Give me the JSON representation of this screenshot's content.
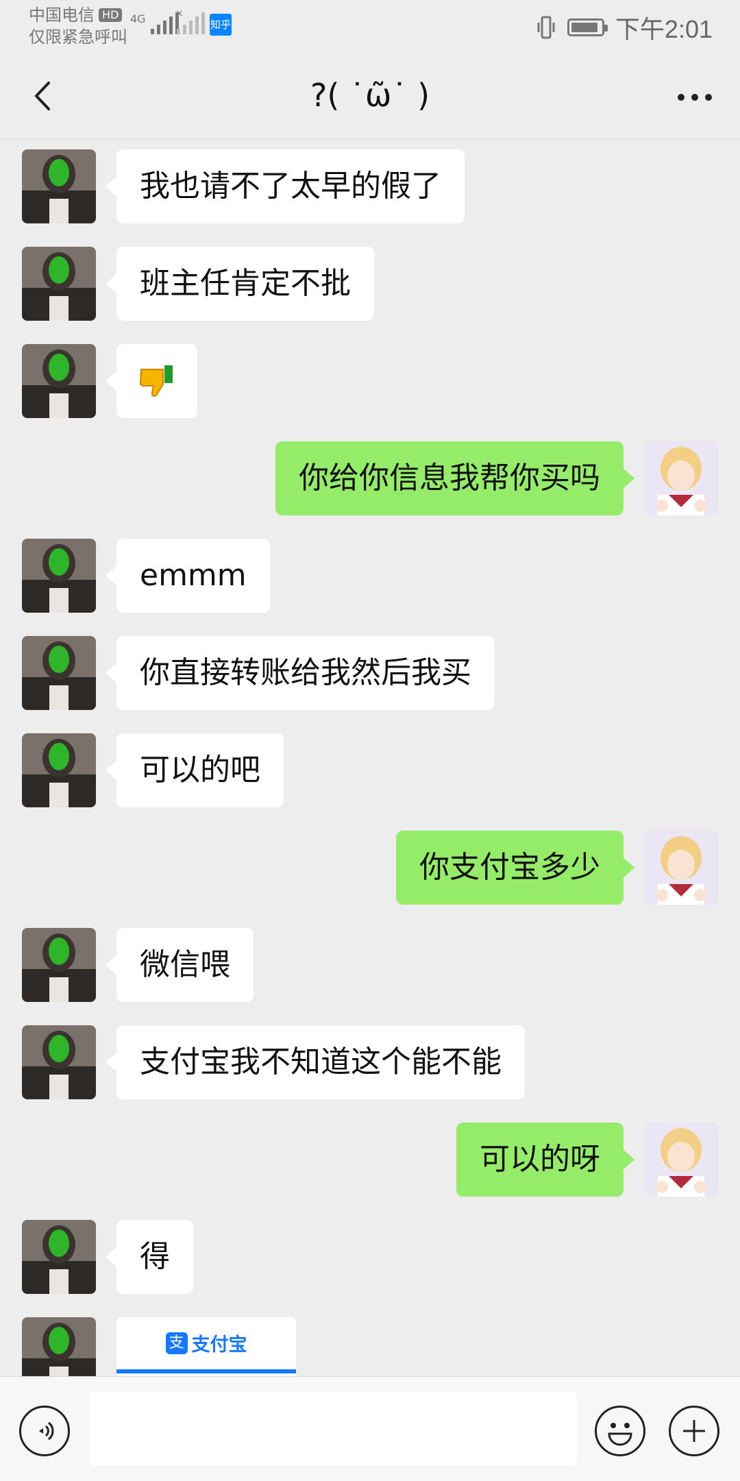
{
  "status_bar": {
    "carrier": "中国电信",
    "hd_badge": "HD",
    "emergency": "仅限紧急呼叫",
    "network": "4G",
    "app_badge": "知乎",
    "time": "下午2:01",
    "icons": [
      "signal-icon",
      "vibrate-icon",
      "battery-icon"
    ]
  },
  "header": {
    "title": "?( ˙ῶ˙ )",
    "back_icon": "chevron-left-icon",
    "more_icon": "more-dots-icon"
  },
  "messages": [
    {
      "side": "left",
      "text": "我也请不了太早的假了"
    },
    {
      "side": "left",
      "text": "班主任肯定不批"
    },
    {
      "side": "left",
      "emoji": "👎"
    },
    {
      "side": "right",
      "text": "你给你信息我帮你买吗"
    },
    {
      "side": "left",
      "text": "emmm"
    },
    {
      "side": "left",
      "text": "你直接转账给我然后我买"
    },
    {
      "side": "left",
      "text": "可以的吧"
    },
    {
      "side": "right",
      "text": "你支付宝多少"
    },
    {
      "side": "left",
      "text": "微信喂"
    },
    {
      "side": "left",
      "text": "支付宝我不知道这个能不能"
    },
    {
      "side": "right",
      "text": "可以的呀"
    },
    {
      "side": "left",
      "text": "得"
    },
    {
      "side": "left",
      "card": "支付宝"
    }
  ],
  "input_bar": {
    "placeholder": "",
    "value": "",
    "icons": [
      "voice-icon",
      "emoji-icon",
      "plus-icon"
    ]
  },
  "colors": {
    "background": "#ededed",
    "sent_bubble": "#95ec69",
    "received_bubble": "#ffffff",
    "alipay_blue": "#1677ff"
  }
}
